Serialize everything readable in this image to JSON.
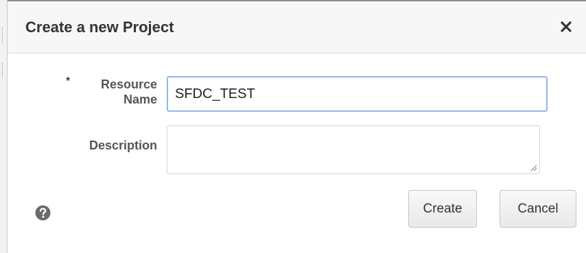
{
  "dialog": {
    "title": "Create a new Project",
    "close_icon": "close-icon"
  },
  "form": {
    "resource_name": {
      "required_marker": "*",
      "label_line1": "Resource",
      "label_line2": "Name",
      "value": "SFDC_TEST"
    },
    "description": {
      "label": "Description",
      "value": ""
    }
  },
  "footer": {
    "help_icon": "help-icon",
    "create_label": "Create",
    "cancel_label": "Cancel"
  },
  "colors": {
    "input_focus_border": "#8fb8e8",
    "title_text": "#333333",
    "label_text": "#555555",
    "header_bg": "#f7f7f7"
  }
}
